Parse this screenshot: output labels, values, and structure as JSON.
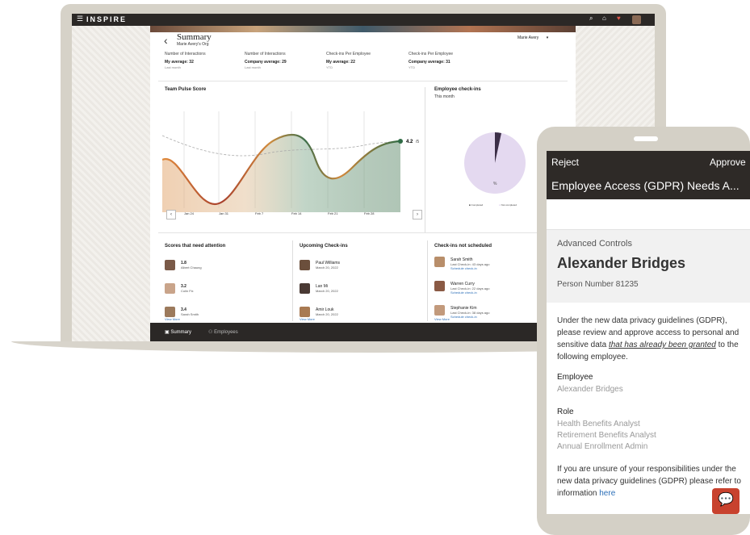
{
  "laptop": {
    "app_bar": {
      "brand": "INSPIRE"
    },
    "header": {
      "title": "Summary",
      "subtitle": "Marie Avery's Org",
      "person_select": "Marie Avery"
    },
    "kpis": [
      {
        "label": "Number of Interactions",
        "value": "My average: 32",
        "sub": "Last month"
      },
      {
        "label": "Number of Interactions",
        "value": "Company average: 29",
        "sub": "Last month"
      },
      {
        "label": "Check-ins Per Employee",
        "value": "My average: 22",
        "sub": "YTD"
      },
      {
        "label": "Check-ins Per Employee",
        "value": "Company average: 31",
        "sub": "YTD"
      }
    ],
    "pulse": {
      "title": "Team Pulse Score",
      "end_value": "4.2",
      "x_ticks": [
        "Jan 24",
        "Jan 31",
        "Feb 7",
        "Feb 14",
        "Feb 21",
        "Feb 28"
      ]
    },
    "checkins_chart": {
      "title": "Employee check-ins",
      "subtitle": "This month",
      "legend": [
        "Completed",
        "Not completed"
      ]
    },
    "attention": {
      "title": "Scores that need attention",
      "rows": [
        {
          "score": "1.8",
          "name": "Albert Chaung"
        },
        {
          "score": "3.2",
          "name": "Colin Fix"
        },
        {
          "score": "3.4",
          "name": "Sarah Smith"
        }
      ],
      "view_more": "View More"
    },
    "upcoming": {
      "title": "Upcoming Check-ins",
      "rows": [
        {
          "name": "Paul Williams",
          "date": "March 20, 2022"
        },
        {
          "name": "Lan Mi",
          "date": "March 20, 2022"
        },
        {
          "name": "Amir Louk",
          "date": "March 20, 2022"
        }
      ],
      "view_more": "View More"
    },
    "not_scheduled": {
      "title": "Check-ins not scheduled",
      "rows": [
        {
          "name": "Sarah Smith",
          "last": "Last Check-in: 43 days ago",
          "action": "Schedule check-in"
        },
        {
          "name": "Warren Curry",
          "last": "Last Check-in: 22 days ago",
          "action": "Schedule check-in"
        },
        {
          "name": "Stephanie Kim",
          "last": "Last Check-in: 38 days ago",
          "action": "Schedule check-in"
        }
      ],
      "view_more": "View More"
    },
    "bottom_nav": {
      "summary": "Summary",
      "employees": "Employees"
    }
  },
  "phone": {
    "reject": "Reject",
    "approve": "Approve",
    "title": "Employee Access (GDPR) Needs A...",
    "section": "Advanced Controls",
    "name": "Alexander Bridges",
    "person_number": "Person Number 81235",
    "body_pre": "Under the new data privacy guidelines (GDPR), please review and approve access to personal and sensitive data ",
    "body_link": "that has already been granted",
    "body_post": " to the following employee.",
    "employee_label": "Employee",
    "employee_value": "Alexander Bridges",
    "role_label": "Role",
    "roles": [
      "Health Benefits Analyst",
      "Retirement Benefits Analyst",
      "Annual Enrollment Admin"
    ],
    "footer_pre": "If you are unsure of your responsibilities under the new data privacy guidelines (GDPR) please refer to information ",
    "footer_link": "here"
  },
  "colors": {
    "dark_bar": "#2b2826",
    "accent_green": "#3c6e4a",
    "link": "#2c6fb8",
    "chat": "#c8422e"
  }
}
